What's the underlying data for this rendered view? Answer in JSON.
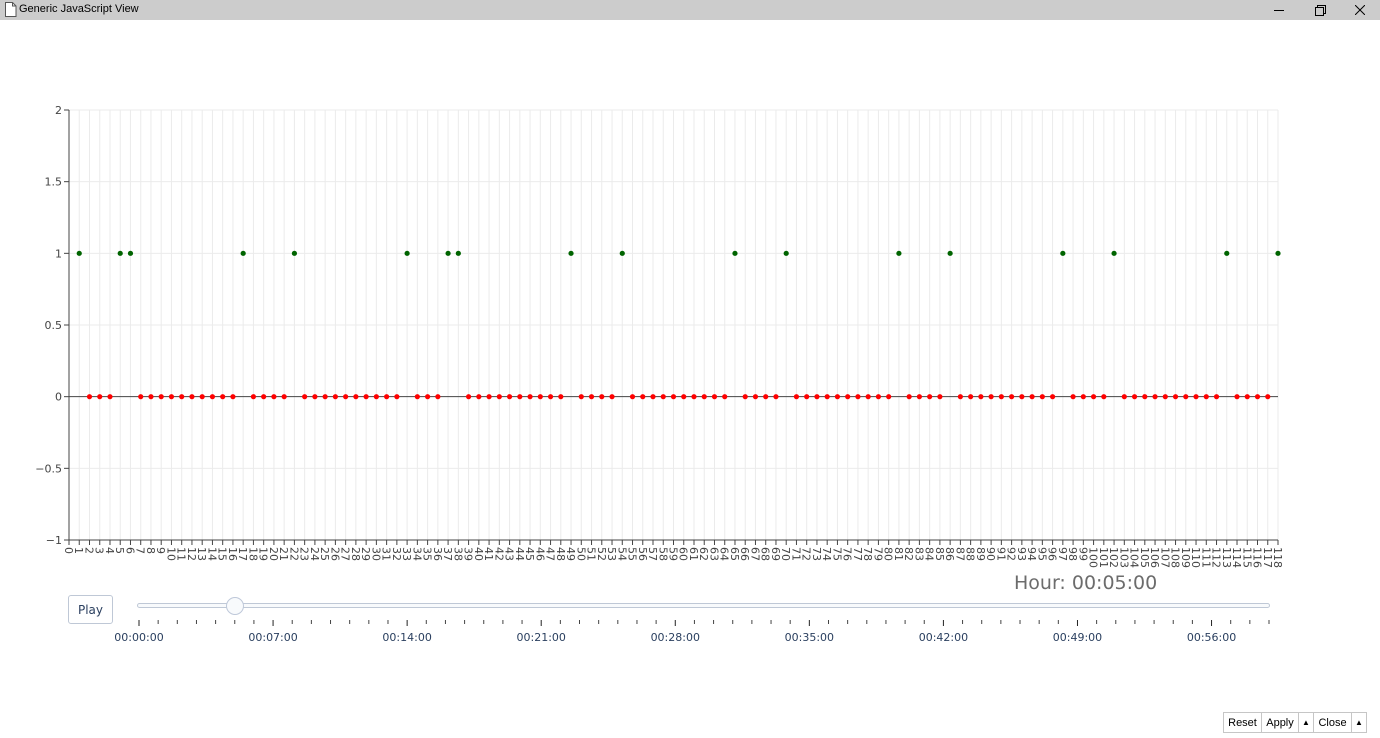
{
  "window": {
    "title": "Generic JavaScript View",
    "icon": "document-icon",
    "controls": [
      "minimize-icon",
      "restore-icon",
      "close-icon"
    ]
  },
  "chart_data": {
    "type": "scatter",
    "title": "",
    "xlabel": "",
    "ylabel": "",
    "xlim": [
      0,
      118
    ],
    "ylim": [
      -1,
      2
    ],
    "y_ticks": [
      "−1",
      "−0.5",
      "0",
      "0.5",
      "1",
      "1.5",
      "2"
    ],
    "x_ticks": [
      0,
      118,
      1
    ],
    "grid": true,
    "legend": "none",
    "colors": {
      "high": "#006400",
      "low": "#ff0000"
    },
    "x": [
      1,
      2,
      3,
      4,
      5,
      6,
      7,
      8,
      9,
      10,
      11,
      12,
      13,
      14,
      15,
      16,
      17,
      18,
      19,
      20,
      21,
      22,
      23,
      24,
      25,
      26,
      27,
      28,
      29,
      30,
      31,
      32,
      33,
      34,
      35,
      36,
      37,
      38,
      39,
      40,
      41,
      42,
      43,
      44,
      45,
      46,
      47,
      48,
      49,
      50,
      51,
      52,
      53,
      54,
      55,
      56,
      57,
      58,
      59,
      60,
      61,
      62,
      63,
      64,
      65,
      66,
      67,
      68,
      69,
      70,
      71,
      72,
      73,
      74,
      75,
      76,
      77,
      78,
      79,
      80,
      81,
      82,
      83,
      84,
      85,
      86,
      87,
      88,
      89,
      90,
      91,
      92,
      93,
      94,
      95,
      96,
      97,
      98,
      99,
      100,
      101,
      102,
      103,
      104,
      105,
      106,
      107,
      108,
      109,
      110,
      111,
      112,
      113,
      114,
      115,
      116,
      117,
      118
    ],
    "y": [
      1,
      0,
      0,
      0,
      1,
      1,
      0,
      0,
      0,
      0,
      0,
      0,
      0,
      0,
      0,
      0,
      1,
      0,
      0,
      0,
      0,
      1,
      0,
      0,
      0,
      0,
      0,
      0,
      0,
      0,
      0,
      0,
      1,
      0,
      0,
      0,
      1,
      1,
      0,
      0,
      0,
      0,
      0,
      0,
      0,
      0,
      0,
      0,
      1,
      0,
      0,
      0,
      0,
      1,
      0,
      0,
      0,
      0,
      0,
      0,
      0,
      0,
      0,
      0,
      1,
      0,
      0,
      0,
      0,
      1,
      0,
      0,
      0,
      0,
      0,
      0,
      0,
      0,
      0,
      0,
      1,
      0,
      0,
      0,
      0,
      1,
      0,
      0,
      0,
      0,
      0,
      0,
      0,
      0,
      0,
      0,
      1,
      0,
      0,
      0,
      0,
      1,
      0,
      0,
      0,
      0,
      0,
      0,
      0,
      0,
      0,
      0,
      1,
      0,
      0,
      0,
      0,
      1
    ]
  },
  "animation": {
    "current_label": "Hour: 00:05:00",
    "play_label": "Play",
    "slider_value_seconds": 300,
    "slider_max_seconds": 3540,
    "slider_step_seconds": 60,
    "tick_labels": [
      "00:00:00",
      "00:07:00",
      "00:14:00",
      "00:21:00",
      "00:28:00",
      "00:35:00",
      "00:42:00",
      "00:49:00",
      "00:56:00"
    ]
  },
  "bottom_bar": {
    "reset": "Reset",
    "apply": "Apply",
    "close": "Close",
    "up_arrow": "▲"
  }
}
